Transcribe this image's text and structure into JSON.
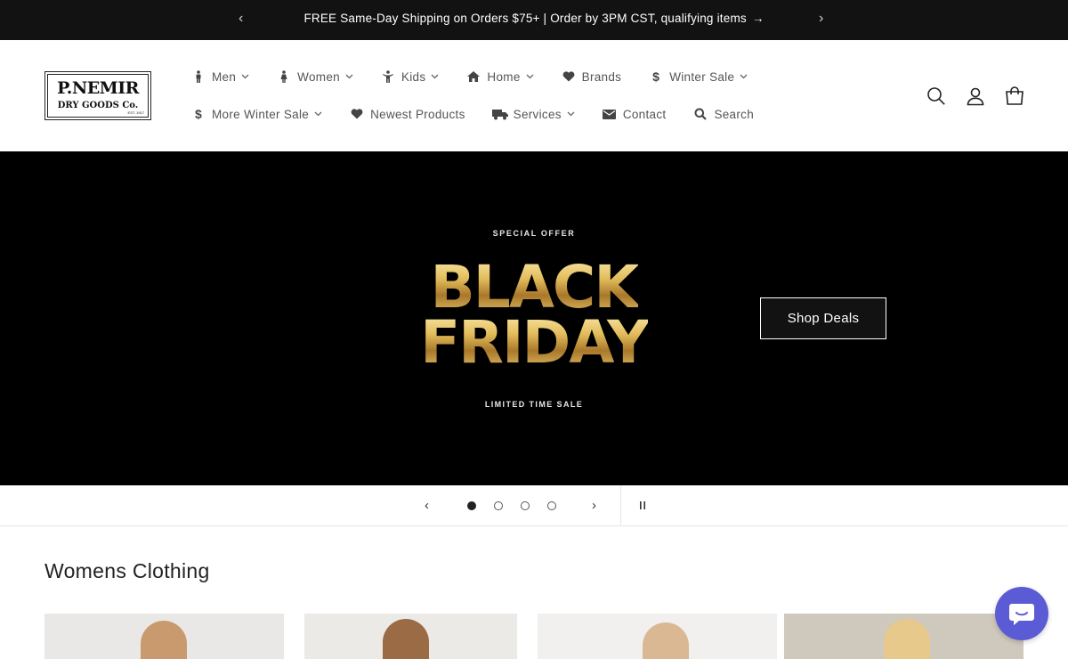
{
  "announcement": {
    "text": "FREE Same-Day Shipping on Orders $75+ | Order by 3PM CST, qualifying items",
    "arrow": "→",
    "prev": "‹",
    "next": "›"
  },
  "logo": {
    "title": "P.NEMIR",
    "subtitle": "DRY GOODS Co.",
    "est": "EST. 1917"
  },
  "nav": {
    "row1": [
      {
        "label": "Men",
        "icon": "person-icon",
        "dropdown": true
      },
      {
        "label": "Women",
        "icon": "person-dress-icon",
        "dropdown": true
      },
      {
        "label": "Kids",
        "icon": "child-icon",
        "dropdown": true
      },
      {
        "label": "Home",
        "icon": "home-icon",
        "dropdown": true
      },
      {
        "label": "Brands",
        "icon": "heart-icon",
        "dropdown": false
      },
      {
        "label": "Winter Sale",
        "icon": "dollar-icon",
        "dropdown": true
      }
    ],
    "row2": [
      {
        "label": "More Winter Sale",
        "icon": "dollar-icon",
        "dropdown": true
      },
      {
        "label": "Newest Products",
        "icon": "heart-icon",
        "dropdown": false
      },
      {
        "label": "Services",
        "icon": "truck-icon",
        "dropdown": true
      },
      {
        "label": "Contact",
        "icon": "envelope-icon",
        "dropdown": false
      },
      {
        "label": "Search",
        "icon": "search-icon",
        "dropdown": false
      }
    ]
  },
  "hero": {
    "eyebrow": "SPECIAL OFFER",
    "headline_1": "BLACK",
    "headline_2": "FRIDAY",
    "tagline": "LIMITED TIME SALE",
    "cta": "Shop Deals"
  },
  "slider": {
    "prev": "‹",
    "next": "›",
    "slides": 4,
    "active": 1
  },
  "collection": {
    "title": "Womens Clothing"
  },
  "colors": {
    "accent": "#5b5bd6",
    "bar": "#121212",
    "gold": "#d6b04e"
  }
}
